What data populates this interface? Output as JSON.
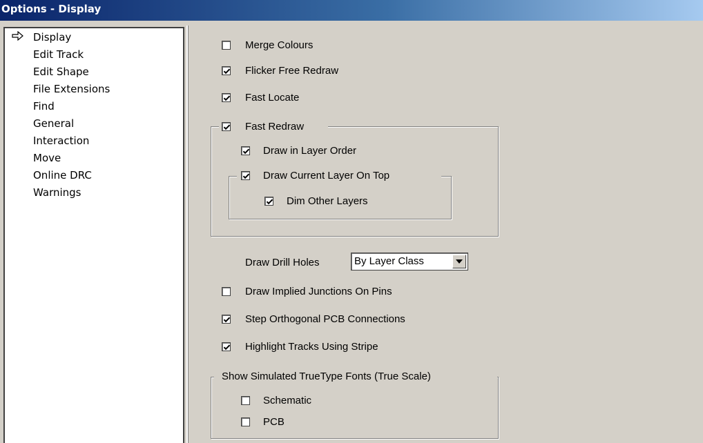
{
  "window": {
    "title": "Options - Display"
  },
  "sidebar": {
    "selected_icon": "arrow-right-icon",
    "items": [
      {
        "label": "Display"
      },
      {
        "label": "Edit Track"
      },
      {
        "label": "Edit Shape"
      },
      {
        "label": "File Extensions"
      },
      {
        "label": "Find"
      },
      {
        "label": "General"
      },
      {
        "label": "Interaction"
      },
      {
        "label": "Move"
      },
      {
        "label": "Online DRC"
      },
      {
        "label": "Warnings"
      }
    ]
  },
  "options": {
    "merge_colours": {
      "label": "Merge Colours",
      "checked": false
    },
    "flicker_free": {
      "label": "Flicker Free Redraw",
      "checked": true
    },
    "fast_locate": {
      "label": "Fast Locate",
      "checked": true
    },
    "fast_redraw": {
      "label": "Fast Redraw",
      "checked": true
    },
    "draw_layer_order": {
      "label": "Draw in Layer Order",
      "checked": true
    },
    "current_layer_top": {
      "label": "Draw Current Layer On Top",
      "checked": true
    },
    "dim_other": {
      "label": "Dim Other Layers",
      "checked": true
    },
    "drill_holes": {
      "label": "Draw Drill Holes",
      "value": "By Layer Class"
    },
    "implied_junctions": {
      "label": "Draw Implied Junctions On Pins",
      "checked": false
    },
    "step_orthogonal": {
      "label": "Step Orthogonal PCB Connections",
      "checked": true
    },
    "highlight_stripe": {
      "label": "Highlight Tracks Using Stripe",
      "checked": true
    },
    "truetype_group": {
      "label": "Show Simulated TrueType Fonts (True Scale)"
    },
    "schematic": {
      "label": "Schematic",
      "checked": false
    },
    "pcb": {
      "label": "PCB",
      "checked": false
    }
  }
}
